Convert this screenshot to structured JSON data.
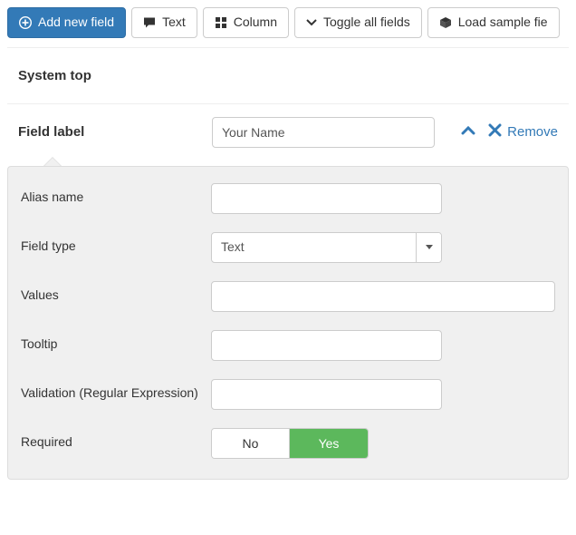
{
  "toolbar": {
    "add_new_field": "Add new field",
    "text": "Text",
    "column": "Column",
    "toggle_all": "Toggle all fields",
    "load_sample": "Load sample fie"
  },
  "section": {
    "title": "System top"
  },
  "field": {
    "label_caption": "Field label",
    "label_value": "Your Name",
    "remove": "Remove"
  },
  "panel": {
    "alias_name": {
      "label": "Alias name",
      "value": ""
    },
    "field_type": {
      "label": "Field type",
      "value": "Text"
    },
    "values": {
      "label": "Values",
      "value": ""
    },
    "tooltip": {
      "label": "Tooltip",
      "value": ""
    },
    "validation": {
      "label": "Validation (Regular Expression)",
      "value": ""
    },
    "required": {
      "label": "Required",
      "no": "No",
      "yes": "Yes",
      "value": "Yes"
    }
  }
}
